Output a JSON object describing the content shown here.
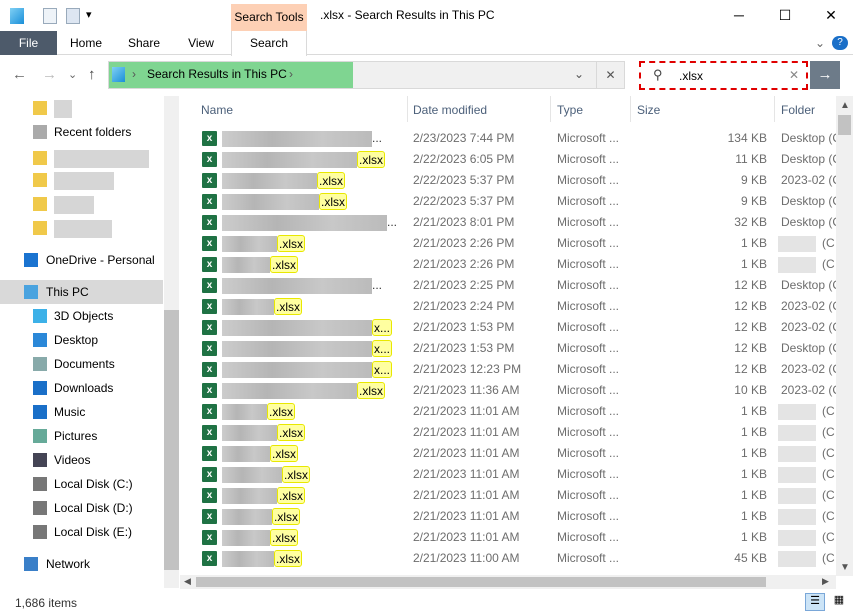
{
  "window": {
    "title": ".xlsx - Search Results in This PC",
    "context_tab": "Search Tools",
    "minimize": "─",
    "maximize": "☐",
    "close": "✕"
  },
  "ribbon": {
    "tabs": [
      "File",
      "Home",
      "Share",
      "View",
      "Search"
    ],
    "expand": "⌄",
    "help": "?"
  },
  "nav": {
    "back": "←",
    "forward": "→",
    "recent": "⌄",
    "up": "↑"
  },
  "address": {
    "path": "Search Results in This PC",
    "dropdown": "⌄",
    "clear": "✕"
  },
  "search": {
    "value": ".xlsx",
    "clear": "✕",
    "go": "→"
  },
  "sidebar": {
    "items": [
      {
        "label": "",
        "icon": "folder-icon"
      },
      {
        "label": "Recent folders",
        "icon": "recent-folders-icon"
      },
      {
        "label": "",
        "icon": "folder-icon"
      },
      {
        "label": "",
        "icon": "folder-icon"
      },
      {
        "label": "",
        "icon": "folder-icon"
      },
      {
        "label": "",
        "icon": "folder-icon"
      },
      {
        "label": "OneDrive - Personal",
        "icon": "onedrive-icon"
      },
      {
        "label": "This PC",
        "icon": "this-pc-icon",
        "selected": true
      },
      {
        "label": "3D Objects",
        "icon": "3d-objects-icon"
      },
      {
        "label": "Desktop",
        "icon": "desktop-icon"
      },
      {
        "label": "Documents",
        "icon": "documents-icon"
      },
      {
        "label": "Downloads",
        "icon": "downloads-icon"
      },
      {
        "label": "Music",
        "icon": "music-icon"
      },
      {
        "label": "Pictures",
        "icon": "pictures-icon"
      },
      {
        "label": "Videos",
        "icon": "videos-icon"
      },
      {
        "label": "Local Disk (C:)",
        "icon": "drive-icon"
      },
      {
        "label": "Local Disk (D:)",
        "icon": "drive-icon"
      },
      {
        "label": "Local Disk (E:)",
        "icon": "drive-icon"
      },
      {
        "label": "Network",
        "icon": "network-icon"
      }
    ]
  },
  "columns": {
    "name": "Name",
    "date": "Date modified",
    "type": "Type",
    "size": "Size",
    "folder": "Folder"
  },
  "files": [
    {
      "suffix": "...",
      "date": "2/23/2023 7:44 PM",
      "type": "Microsoft ...",
      "size": "134 KB",
      "folder": "Desktop (C"
    },
    {
      "suffix": ".xlsx",
      "date": "2/22/2023 6:05 PM",
      "type": "Microsoft ...",
      "size": "11 KB",
      "folder": "Desktop (C"
    },
    {
      "suffix": ".xlsx",
      "date": "2/22/2023 5:37 PM",
      "type": "Microsoft ...",
      "size": "9 KB",
      "folder": "2023-02 (C"
    },
    {
      "suffix": ".xlsx",
      "date": "2/22/2023 5:37 PM",
      "type": "Microsoft ...",
      "size": "9 KB",
      "folder": "Desktop (C"
    },
    {
      "suffix": "...",
      "date": "2/21/2023 8:01 PM",
      "type": "Microsoft ...",
      "size": "32 KB",
      "folder": "Desktop (C"
    },
    {
      "suffix": ".xlsx",
      "date": "2/21/2023 2:26 PM",
      "type": "Microsoft ...",
      "size": "1 KB",
      "folder": "(C"
    },
    {
      "suffix": ".xlsx",
      "date": "2/21/2023 2:26 PM",
      "type": "Microsoft ...",
      "size": "1 KB",
      "folder": "(C"
    },
    {
      "suffix": "...",
      "date": "2/21/2023 2:25 PM",
      "type": "Microsoft ...",
      "size": "12 KB",
      "folder": "Desktop (C"
    },
    {
      "suffix": ".xlsx",
      "date": "2/21/2023 2:24 PM",
      "type": "Microsoft ...",
      "size": "12 KB",
      "folder": "2023-02 (C"
    },
    {
      "suffix": "x...",
      "date": "2/21/2023 1:53 PM",
      "type": "Microsoft ...",
      "size": "12 KB",
      "folder": "2023-02 (C"
    },
    {
      "suffix": "x...",
      "date": "2/21/2023 1:53 PM",
      "type": "Microsoft ...",
      "size": "12 KB",
      "folder": "Desktop (C"
    },
    {
      "suffix": "x...",
      "date": "2/21/2023 12:23 PM",
      "type": "Microsoft ...",
      "size": "12 KB",
      "folder": "2023-02 (C"
    },
    {
      "suffix": ".xlsx",
      "date": "2/21/2023 11:36 AM",
      "type": "Microsoft ...",
      "size": "10 KB",
      "folder": "2023-02 (C"
    },
    {
      "suffix": ".xlsx",
      "date": "2/21/2023 11:01 AM",
      "type": "Microsoft ...",
      "size": "1 KB",
      "folder": "(C"
    },
    {
      "suffix": ".xlsx",
      "date": "2/21/2023 11:01 AM",
      "type": "Microsoft ...",
      "size": "1 KB",
      "folder": "(C"
    },
    {
      "suffix": ".xlsx",
      "date": "2/21/2023 11:01 AM",
      "type": "Microsoft ...",
      "size": "1 KB",
      "folder": "(C"
    },
    {
      "suffix": ".xlsx",
      "date": "2/21/2023 11:01 AM",
      "type": "Microsoft ...",
      "size": "1 KB",
      "folder": "(C"
    },
    {
      "suffix": ".xlsx",
      "date": "2/21/2023 11:01 AM",
      "type": "Microsoft ...",
      "size": "1 KB",
      "folder": "(C"
    },
    {
      "suffix": ".xlsx",
      "date": "2/21/2023 11:01 AM",
      "type": "Microsoft ...",
      "size": "1 KB",
      "folder": "(C"
    },
    {
      "suffix": ".xlsx",
      "date": "2/21/2023 11:01 AM",
      "type": "Microsoft ...",
      "size": "1 KB",
      "folder": "(C"
    },
    {
      "suffix": ".xlsx",
      "date": "2/21/2023 11:00 AM",
      "type": "Microsoft ...",
      "size": "45 KB",
      "folder": "(C"
    }
  ],
  "status": {
    "count": "1,686 items"
  },
  "colors": {
    "file_tab": "#4d5a6a",
    "context_tab": "#fdd0b5",
    "address_highlight": "#7fd591",
    "search_highlight": "#ffffa0",
    "excel": "#1f7244",
    "search_border": "#e00000"
  }
}
